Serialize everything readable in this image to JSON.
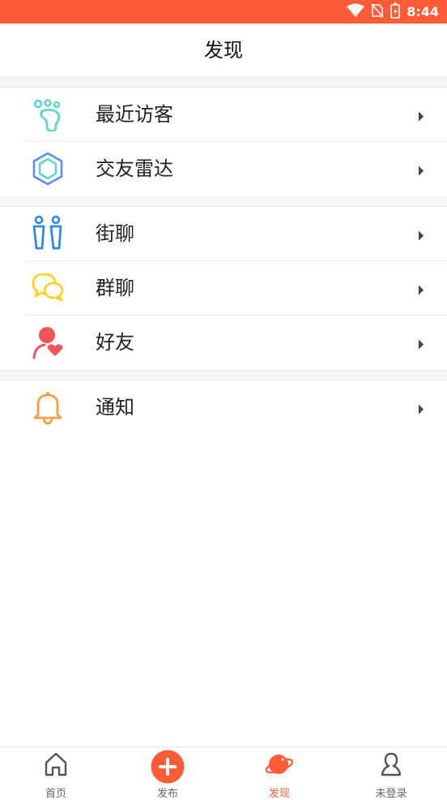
{
  "status_bar": {
    "time": "8:44"
  },
  "header": {
    "title": "发现"
  },
  "menu": [
    {
      "key": "recent-visitors",
      "label": "最近访客",
      "icon": "footprint-icon"
    },
    {
      "key": "friend-radar",
      "label": "交友雷达",
      "icon": "radar-hexagon-icon"
    },
    {
      "key": "street-chat",
      "label": "街聊",
      "icon": "people-icon"
    },
    {
      "key": "group-chat",
      "label": "群聊",
      "icon": "chat-bubbles-icon"
    },
    {
      "key": "friends",
      "label": "好友",
      "icon": "user-heart-icon"
    },
    {
      "key": "notifications",
      "label": "通知",
      "icon": "bell-icon"
    }
  ],
  "tabbar": {
    "items": [
      {
        "label": "首页",
        "icon": "home-icon"
      },
      {
        "label": "发布",
        "icon": "plus-circle-icon"
      },
      {
        "label": "发现",
        "icon": "planet-icon",
        "active": true
      },
      {
        "label": "未登录",
        "icon": "user-icon"
      }
    ]
  },
  "colors": {
    "accent": "#ff5b36",
    "footprint": "#5fd7c7",
    "radar": "#5b8def",
    "people": "#2a8be8",
    "chat": "#ffd21f",
    "friend": "#f2545b",
    "bell": "#ff9c40"
  }
}
